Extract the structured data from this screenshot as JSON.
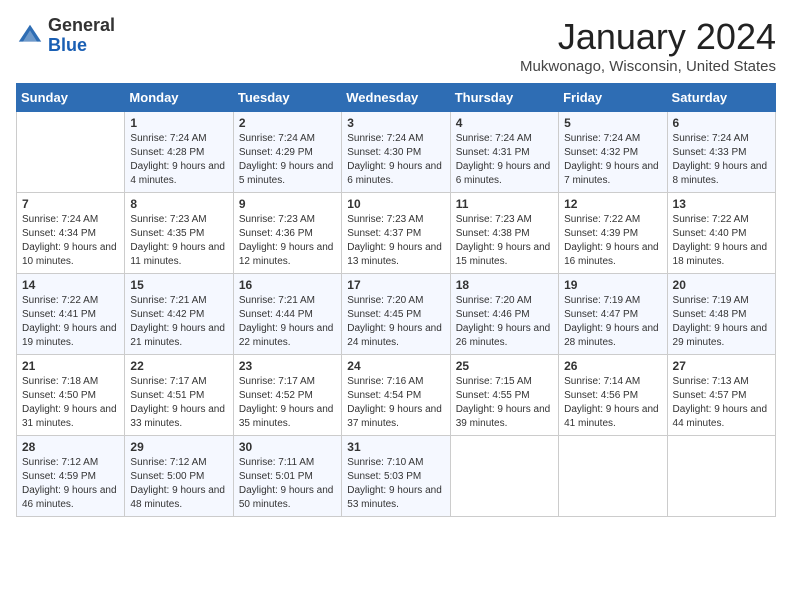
{
  "logo": {
    "general": "General",
    "blue": "Blue"
  },
  "title": "January 2024",
  "location": "Mukwonago, Wisconsin, United States",
  "days_header": [
    "Sunday",
    "Monday",
    "Tuesday",
    "Wednesday",
    "Thursday",
    "Friday",
    "Saturday"
  ],
  "weeks": [
    [
      {
        "num": "",
        "sunrise": "",
        "sunset": "",
        "daylight": ""
      },
      {
        "num": "1",
        "sunrise": "Sunrise: 7:24 AM",
        "sunset": "Sunset: 4:28 PM",
        "daylight": "Daylight: 9 hours and 4 minutes."
      },
      {
        "num": "2",
        "sunrise": "Sunrise: 7:24 AM",
        "sunset": "Sunset: 4:29 PM",
        "daylight": "Daylight: 9 hours and 5 minutes."
      },
      {
        "num": "3",
        "sunrise": "Sunrise: 7:24 AM",
        "sunset": "Sunset: 4:30 PM",
        "daylight": "Daylight: 9 hours and 6 minutes."
      },
      {
        "num": "4",
        "sunrise": "Sunrise: 7:24 AM",
        "sunset": "Sunset: 4:31 PM",
        "daylight": "Daylight: 9 hours and 6 minutes."
      },
      {
        "num": "5",
        "sunrise": "Sunrise: 7:24 AM",
        "sunset": "Sunset: 4:32 PM",
        "daylight": "Daylight: 9 hours and 7 minutes."
      },
      {
        "num": "6",
        "sunrise": "Sunrise: 7:24 AM",
        "sunset": "Sunset: 4:33 PM",
        "daylight": "Daylight: 9 hours and 8 minutes."
      }
    ],
    [
      {
        "num": "7",
        "sunrise": "Sunrise: 7:24 AM",
        "sunset": "Sunset: 4:34 PM",
        "daylight": "Daylight: 9 hours and 10 minutes."
      },
      {
        "num": "8",
        "sunrise": "Sunrise: 7:23 AM",
        "sunset": "Sunset: 4:35 PM",
        "daylight": "Daylight: 9 hours and 11 minutes."
      },
      {
        "num": "9",
        "sunrise": "Sunrise: 7:23 AM",
        "sunset": "Sunset: 4:36 PM",
        "daylight": "Daylight: 9 hours and 12 minutes."
      },
      {
        "num": "10",
        "sunrise": "Sunrise: 7:23 AM",
        "sunset": "Sunset: 4:37 PM",
        "daylight": "Daylight: 9 hours and 13 minutes."
      },
      {
        "num": "11",
        "sunrise": "Sunrise: 7:23 AM",
        "sunset": "Sunset: 4:38 PM",
        "daylight": "Daylight: 9 hours and 15 minutes."
      },
      {
        "num": "12",
        "sunrise": "Sunrise: 7:22 AM",
        "sunset": "Sunset: 4:39 PM",
        "daylight": "Daylight: 9 hours and 16 minutes."
      },
      {
        "num": "13",
        "sunrise": "Sunrise: 7:22 AM",
        "sunset": "Sunset: 4:40 PM",
        "daylight": "Daylight: 9 hours and 18 minutes."
      }
    ],
    [
      {
        "num": "14",
        "sunrise": "Sunrise: 7:22 AM",
        "sunset": "Sunset: 4:41 PM",
        "daylight": "Daylight: 9 hours and 19 minutes."
      },
      {
        "num": "15",
        "sunrise": "Sunrise: 7:21 AM",
        "sunset": "Sunset: 4:42 PM",
        "daylight": "Daylight: 9 hours and 21 minutes."
      },
      {
        "num": "16",
        "sunrise": "Sunrise: 7:21 AM",
        "sunset": "Sunset: 4:44 PM",
        "daylight": "Daylight: 9 hours and 22 minutes."
      },
      {
        "num": "17",
        "sunrise": "Sunrise: 7:20 AM",
        "sunset": "Sunset: 4:45 PM",
        "daylight": "Daylight: 9 hours and 24 minutes."
      },
      {
        "num": "18",
        "sunrise": "Sunrise: 7:20 AM",
        "sunset": "Sunset: 4:46 PM",
        "daylight": "Daylight: 9 hours and 26 minutes."
      },
      {
        "num": "19",
        "sunrise": "Sunrise: 7:19 AM",
        "sunset": "Sunset: 4:47 PM",
        "daylight": "Daylight: 9 hours and 28 minutes."
      },
      {
        "num": "20",
        "sunrise": "Sunrise: 7:19 AM",
        "sunset": "Sunset: 4:48 PM",
        "daylight": "Daylight: 9 hours and 29 minutes."
      }
    ],
    [
      {
        "num": "21",
        "sunrise": "Sunrise: 7:18 AM",
        "sunset": "Sunset: 4:50 PM",
        "daylight": "Daylight: 9 hours and 31 minutes."
      },
      {
        "num": "22",
        "sunrise": "Sunrise: 7:17 AM",
        "sunset": "Sunset: 4:51 PM",
        "daylight": "Daylight: 9 hours and 33 minutes."
      },
      {
        "num": "23",
        "sunrise": "Sunrise: 7:17 AM",
        "sunset": "Sunset: 4:52 PM",
        "daylight": "Daylight: 9 hours and 35 minutes."
      },
      {
        "num": "24",
        "sunrise": "Sunrise: 7:16 AM",
        "sunset": "Sunset: 4:54 PM",
        "daylight": "Daylight: 9 hours and 37 minutes."
      },
      {
        "num": "25",
        "sunrise": "Sunrise: 7:15 AM",
        "sunset": "Sunset: 4:55 PM",
        "daylight": "Daylight: 9 hours and 39 minutes."
      },
      {
        "num": "26",
        "sunrise": "Sunrise: 7:14 AM",
        "sunset": "Sunset: 4:56 PM",
        "daylight": "Daylight: 9 hours and 41 minutes."
      },
      {
        "num": "27",
        "sunrise": "Sunrise: 7:13 AM",
        "sunset": "Sunset: 4:57 PM",
        "daylight": "Daylight: 9 hours and 44 minutes."
      }
    ],
    [
      {
        "num": "28",
        "sunrise": "Sunrise: 7:12 AM",
        "sunset": "Sunset: 4:59 PM",
        "daylight": "Daylight: 9 hours and 46 minutes."
      },
      {
        "num": "29",
        "sunrise": "Sunrise: 7:12 AM",
        "sunset": "Sunset: 5:00 PM",
        "daylight": "Daylight: 9 hours and 48 minutes."
      },
      {
        "num": "30",
        "sunrise": "Sunrise: 7:11 AM",
        "sunset": "Sunset: 5:01 PM",
        "daylight": "Daylight: 9 hours and 50 minutes."
      },
      {
        "num": "31",
        "sunrise": "Sunrise: 7:10 AM",
        "sunset": "Sunset: 5:03 PM",
        "daylight": "Daylight: 9 hours and 53 minutes."
      },
      {
        "num": "",
        "sunrise": "",
        "sunset": "",
        "daylight": ""
      },
      {
        "num": "",
        "sunrise": "",
        "sunset": "",
        "daylight": ""
      },
      {
        "num": "",
        "sunrise": "",
        "sunset": "",
        "daylight": ""
      }
    ]
  ]
}
